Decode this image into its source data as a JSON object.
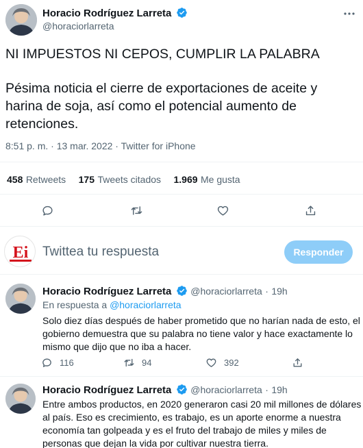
{
  "tweet": {
    "author": {
      "name": "Horacio Rodríguez Larreta",
      "handle": "@horaciorlarreta"
    },
    "headline": "NI IMPUESTOS NI CEPOS, CUMPLIR LA PALABRA",
    "body_lines": [
      "Pésima noticia el cierre de exportaciones de aceite y",
      "harina de soja, así como el potencial aumento de",
      "retenciones."
    ],
    "meta": "8:51 p. m. · 13 mar. 2022 · Twitter for iPhone",
    "stats": {
      "retweets_num": "458",
      "retweets_label": "Retweets",
      "quotes_num": "175",
      "quotes_label": "Tweets citados",
      "likes_num": "1.969",
      "likes_label": "Me gusta"
    }
  },
  "compose": {
    "placeholder": "Twittea tu respuesta",
    "reply_button": "Responder",
    "avatar_logo": "Ei"
  },
  "replies": [
    {
      "name": "Horacio Rodríguez Larreta",
      "handle": "@horaciorlarreta",
      "dot": "·",
      "time": "19h",
      "in_reply_prefix": "En respuesta a",
      "in_reply_handle": "@horaciorlarreta",
      "lines": [
        "Solo diez días después de haber prometido que no harían nada de esto, el",
        "gobierno demuestra que su palabra no tiene valor y hace exactamente lo",
        "mismo que dijo que no iba a hacer."
      ],
      "replies_count": "116",
      "retweets_count": "94",
      "likes_count": "392"
    },
    {
      "name": "Horacio Rodríguez Larreta",
      "handle": "@horaciorlarreta",
      "dot": "·",
      "time": "19h",
      "lines": [
        "Entre ambos productos, en 2020 generaron casi 20 mil millones de dólares",
        "al país. Eso es crecimiento, es trabajo, es un aporte enorme a nuestra",
        "economía tan golpeada y es el fruto del trabajo de miles y miles de",
        "personas que dejan la vida por cultivar nuestra tierra."
      ]
    }
  ],
  "colors": {
    "accent": "#1d9bf0",
    "button_disabled": "#8ecdf8",
    "text": "#0f1419",
    "muted": "#536471"
  },
  "icons": [
    "verified-badge-icon",
    "more-icon",
    "reply-icon",
    "retweet-icon",
    "like-icon",
    "share-icon"
  ]
}
